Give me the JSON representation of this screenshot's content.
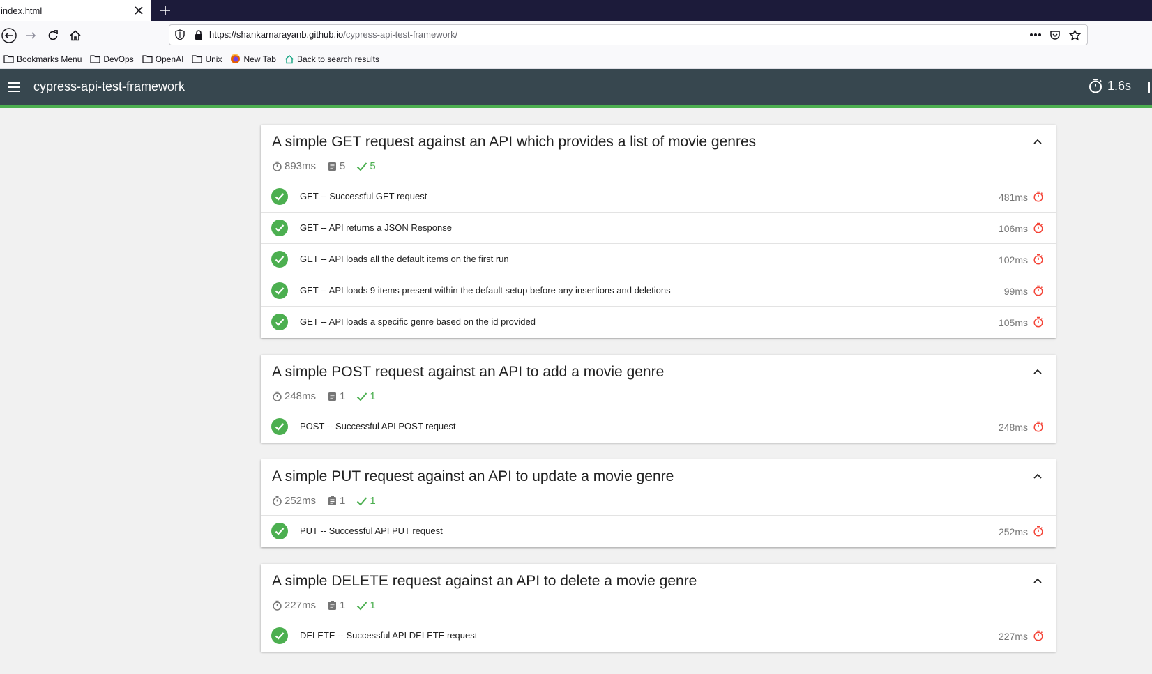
{
  "browser": {
    "tab_title": "index.html",
    "url_host": "https://shankarnarayanb.github.io",
    "url_path": "/cypress-api-test-framework/",
    "bookmarks": [
      {
        "label": "Bookmarks Menu",
        "icon": "folder-icon"
      },
      {
        "label": "DevOps",
        "icon": "folder-icon"
      },
      {
        "label": "OpenAI",
        "icon": "folder-icon"
      },
      {
        "label": "Unix",
        "icon": "folder-icon"
      },
      {
        "label": "New Tab",
        "icon": "firefox-icon"
      },
      {
        "label": "Back to search results",
        "icon": "house-icon"
      }
    ]
  },
  "app": {
    "title": "cypress-api-test-framework",
    "total_duration": "1.6s"
  },
  "colors": {
    "header_bg": "#37474f",
    "pass_green": "#4caf50",
    "clock_red": "#f44336"
  },
  "suites": [
    {
      "title": "A simple GET request against an API which provides a list of movie genres",
      "duration": "893ms",
      "tests_count": "5",
      "passed_count": "5",
      "tests": [
        {
          "title": "GET -- Successful GET request",
          "duration": "481ms"
        },
        {
          "title": "GET -- API returns a JSON Response",
          "duration": "106ms"
        },
        {
          "title": "GET -- API loads all the default items on the first run",
          "duration": "102ms"
        },
        {
          "title": "GET -- API loads 9 items present within the default setup before any insertions and deletions",
          "duration": "99ms"
        },
        {
          "title": "GET -- API loads a specific genre based on the id provided",
          "duration": "105ms"
        }
      ]
    },
    {
      "title": "A simple POST request against an API to add a movie genre",
      "duration": "248ms",
      "tests_count": "1",
      "passed_count": "1",
      "tests": [
        {
          "title": "POST -- Successful API POST request",
          "duration": "248ms"
        }
      ]
    },
    {
      "title": "A simple PUT request against an API to update a movie genre",
      "duration": "252ms",
      "tests_count": "1",
      "passed_count": "1",
      "tests": [
        {
          "title": "PUT -- Successful API PUT request",
          "duration": "252ms"
        }
      ]
    },
    {
      "title": "A simple DELETE request against an API to delete a movie genre",
      "duration": "227ms",
      "tests_count": "1",
      "passed_count": "1",
      "tests": [
        {
          "title": "DELETE -- Successful API DELETE request",
          "duration": "227ms"
        }
      ]
    }
  ]
}
